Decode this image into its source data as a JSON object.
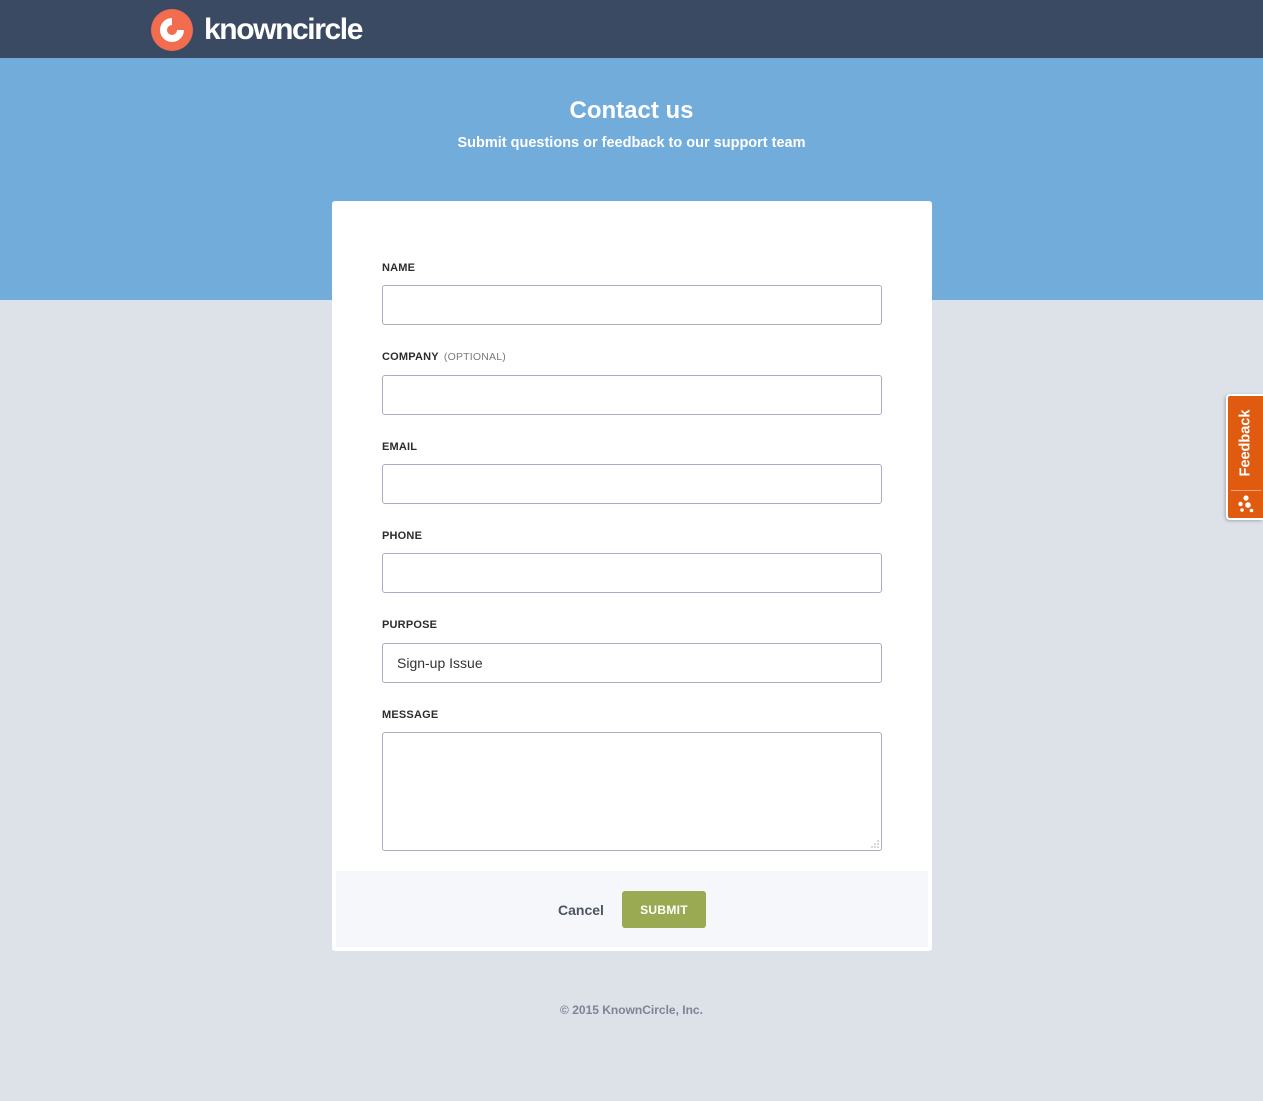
{
  "header": {
    "brand_name": "knowncircle",
    "logo_icon": "knowncircle-logo-icon",
    "brand_color": "#f26c4f",
    "bar_color": "#3b4a63"
  },
  "hero": {
    "title": "Contact us",
    "subtitle": "Submit questions or feedback to our support team",
    "background_color": "#72acdb"
  },
  "form": {
    "fields": {
      "name": {
        "label": "NAME",
        "value": "",
        "placeholder": ""
      },
      "company": {
        "label": "COMPANY",
        "optional_note": "(OPTIONAL)",
        "value": "",
        "placeholder": ""
      },
      "email": {
        "label": "EMAIL",
        "value": "",
        "placeholder": ""
      },
      "phone": {
        "label": "PHONE",
        "value": "",
        "placeholder": ""
      },
      "purpose": {
        "label": "PURPOSE",
        "selected": "Sign-up Issue"
      },
      "message": {
        "label": "MESSAGE",
        "value": "",
        "placeholder": ""
      }
    },
    "actions": {
      "cancel_label": "Cancel",
      "submit_label": "SUBMIT",
      "submit_color": "#9aaa52"
    }
  },
  "footer": {
    "copyright": "© 2015 KnownCircle, Inc."
  },
  "feedback_tab": {
    "label": "Feedback",
    "icon": "dots-cluster-icon",
    "color": "#e05a10"
  }
}
